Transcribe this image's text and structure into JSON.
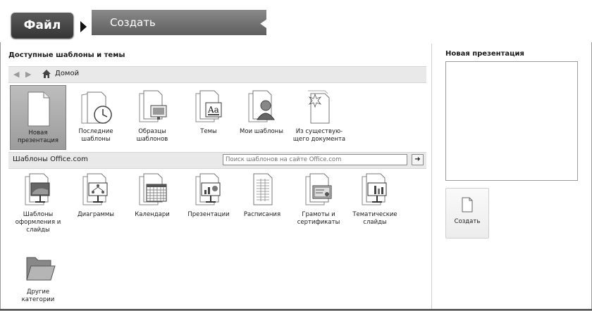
{
  "header": {
    "file_tab": "Файл",
    "create_tab": "Создать"
  },
  "left": {
    "section_title": "Доступные шаблоны и темы",
    "nav": {
      "home_label": "Домой"
    },
    "top_tiles": [
      {
        "label": "Новая презентация",
        "icon": "blank-doc-icon",
        "selected": true
      },
      {
        "label": "Последние шаблоны",
        "icon": "recent-clock-icon"
      },
      {
        "label": "Образцы шаблонов",
        "icon": "sample-templates-icon"
      },
      {
        "label": "Темы",
        "icon": "themes-icon"
      },
      {
        "label": "Мои шаблоны",
        "icon": "my-templates-icon"
      },
      {
        "label": "Из существую-щего документа",
        "icon": "from-existing-icon"
      }
    ],
    "office": {
      "title": "Шаблоны Office.com",
      "search_placeholder": "Поиск шаблонов на сайте Office.com"
    },
    "office_tiles": [
      {
        "label": "Шаблоны оформления и слайды",
        "icon": "design-slides-icon"
      },
      {
        "label": "Диаграммы",
        "icon": "diagrams-icon"
      },
      {
        "label": "Календари",
        "icon": "calendars-icon"
      },
      {
        "label": "Презентации",
        "icon": "presentations-icon"
      },
      {
        "label": "Расписания",
        "icon": "schedules-icon"
      },
      {
        "label": "Грамоты и сертификаты",
        "icon": "certificates-icon"
      },
      {
        "label": "Тематические слайды",
        "icon": "themed-slides-icon"
      },
      {
        "label": "Другие категории",
        "icon": "folder-icon"
      }
    ]
  },
  "right": {
    "preview_title": "Новая презентация",
    "create_button": "Создать"
  }
}
